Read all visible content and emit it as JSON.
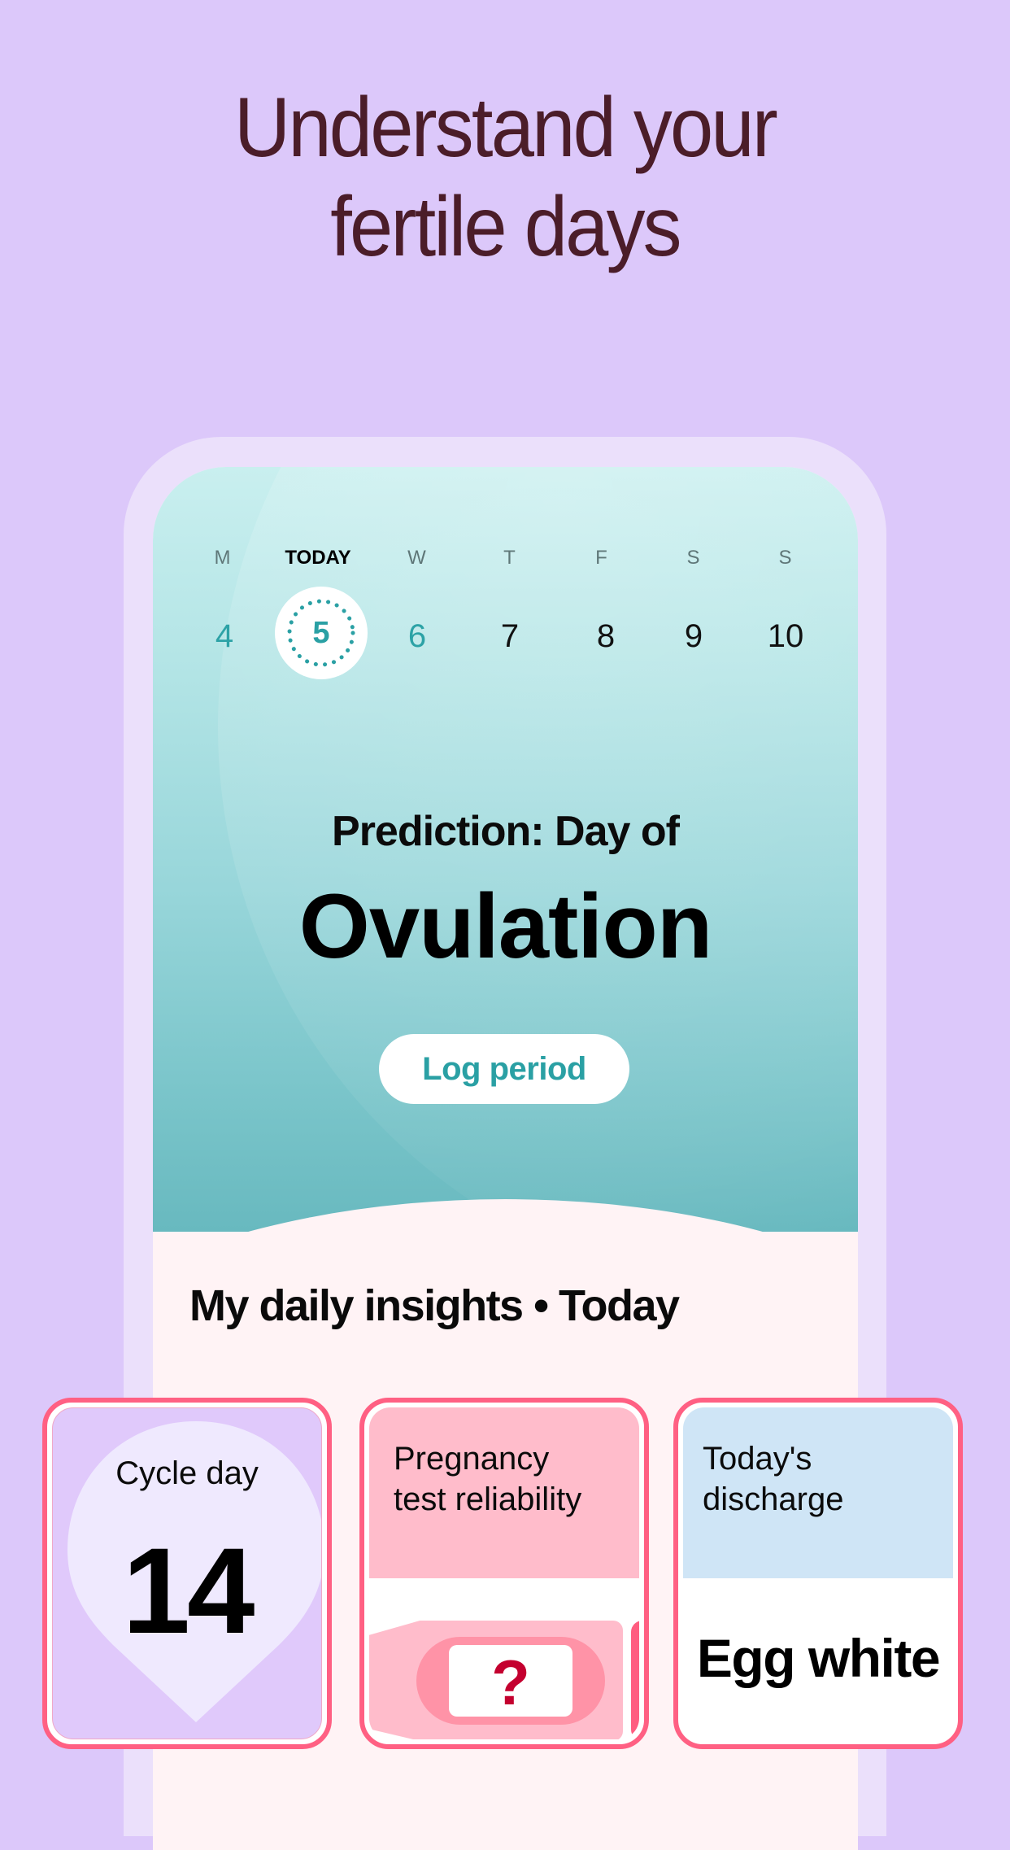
{
  "headline": {
    "line1": "Understand your",
    "line2": "fertile days"
  },
  "week": {
    "days": [
      {
        "dow": "M",
        "num": "4",
        "style": "teal"
      },
      {
        "dow": "TODAY",
        "num": "5",
        "style": "today"
      },
      {
        "dow": "W",
        "num": "6",
        "style": "teal"
      },
      {
        "dow": "T",
        "num": "7",
        "style": "normal"
      },
      {
        "dow": "F",
        "num": "8",
        "style": "normal"
      },
      {
        "dow": "S",
        "num": "9",
        "style": "normal"
      },
      {
        "dow": "S",
        "num": "10",
        "style": "normal"
      }
    ]
  },
  "prediction": {
    "label": "Prediction: Day of",
    "value": "Ovulation",
    "button_label": "Log period"
  },
  "insights": {
    "title": "My daily insights • Today",
    "cards": [
      {
        "title": "Cycle day",
        "value": "14"
      },
      {
        "title_line1": "Pregnancy",
        "title_line2": "test reliability",
        "icon": "question-mark",
        "value": "?"
      },
      {
        "title_line1": "Today's",
        "title_line2": "discharge",
        "value": "Egg white"
      }
    ]
  },
  "colors": {
    "background": "#dcc8fa",
    "headline": "#4b1d29",
    "accent_teal": "#2aa0a4",
    "card_border": "#ff6083",
    "pregnancy_card": "#ffbccb",
    "discharge_card": "#cfe5f6",
    "cycle_card": "#e0c9fb"
  }
}
